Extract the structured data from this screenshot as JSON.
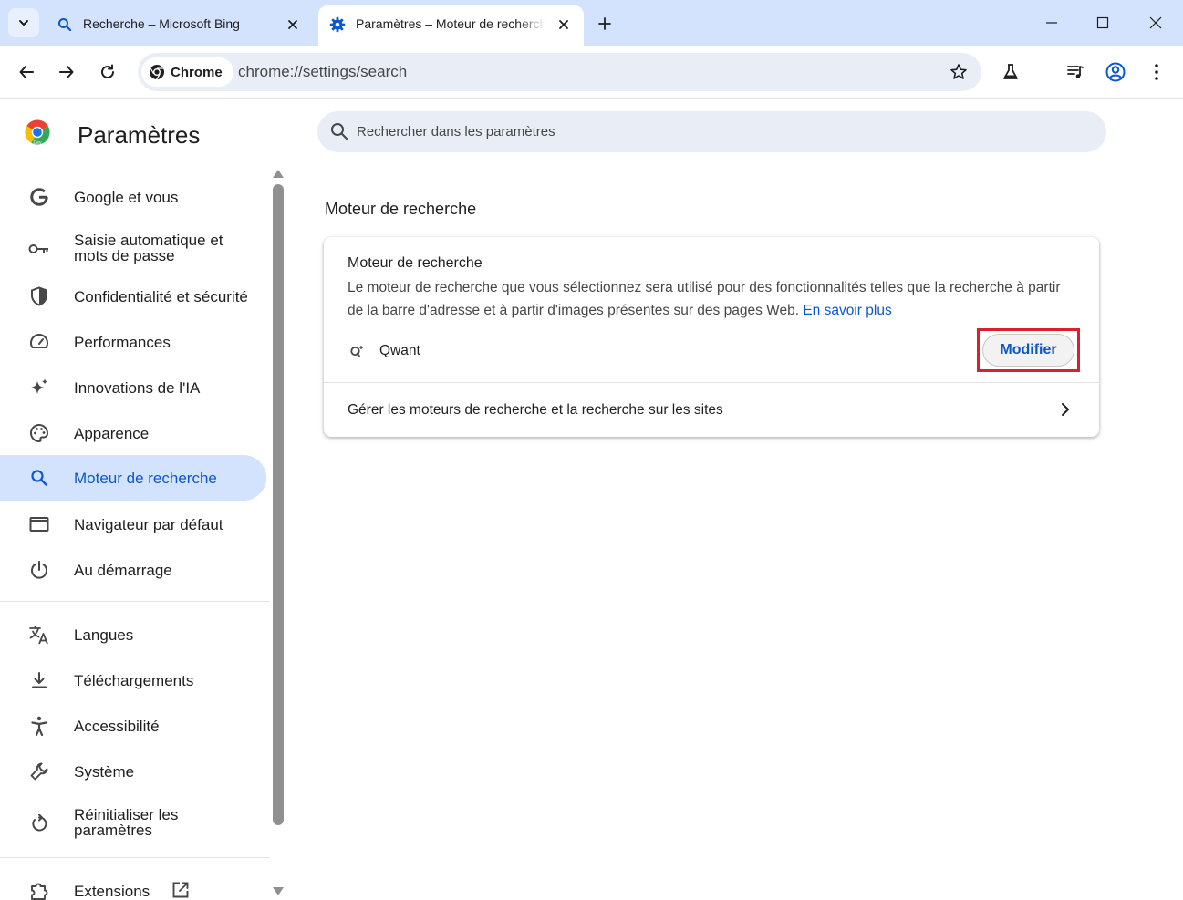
{
  "tabs": [
    {
      "title": "Recherche – Microsoft Bing",
      "active": false
    },
    {
      "title": "Paramètres – Moteur de recherche",
      "active": true
    }
  ],
  "omnibox": {
    "chip_label": "Chrome",
    "url": "chrome://settings/search"
  },
  "sidebar": {
    "title": "Paramètres",
    "items": [
      {
        "label": "Google et vous",
        "icon": "google-g-icon"
      },
      {
        "label": "Saisie automatique et mots de passe",
        "icon": "key-icon"
      },
      {
        "label": "Confidentialité et sécurité",
        "icon": "shield-icon"
      },
      {
        "label": "Performances",
        "icon": "speedometer-icon"
      },
      {
        "label": "Innovations de l'IA",
        "icon": "sparkle-icon"
      },
      {
        "label": "Apparence",
        "icon": "palette-icon"
      },
      {
        "label": "Moteur de recherche",
        "icon": "search-icon",
        "selected": true
      },
      {
        "label": "Navigateur par défaut",
        "icon": "browser-window-icon"
      },
      {
        "label": "Au démarrage",
        "icon": "power-icon"
      },
      {
        "label": "Langues",
        "icon": "translate-icon"
      },
      {
        "label": "Téléchargements",
        "icon": "download-icon"
      },
      {
        "label": "Accessibilité",
        "icon": "accessibility-icon"
      },
      {
        "label": "Système",
        "icon": "wrench-icon"
      },
      {
        "label": "Réinitialiser les paramètres",
        "icon": "reset-icon"
      },
      {
        "label": "Extensions",
        "icon": "puzzle-icon"
      }
    ]
  },
  "search": {
    "placeholder": "Rechercher dans les paramètres"
  },
  "main": {
    "section_title": "Moteur de recherche",
    "card": {
      "title": "Moteur de recherche",
      "description": "Le moteur de recherche que vous sélectionnez sera utilisé pour des fonctionnalités telles que la recherche à partir de la barre d'adresse et à partir d'images présentes sur des pages Web.",
      "learn_more": "En savoir plus",
      "engine_name": "Qwant",
      "modify_label": "Modifier",
      "manage_label": "Gérer les moteurs de recherche et la recherche sur les sites"
    }
  },
  "colors": {
    "accent": "#0b57d0",
    "selected_bg": "#d3e3fd",
    "highlight": "#d9202f"
  }
}
